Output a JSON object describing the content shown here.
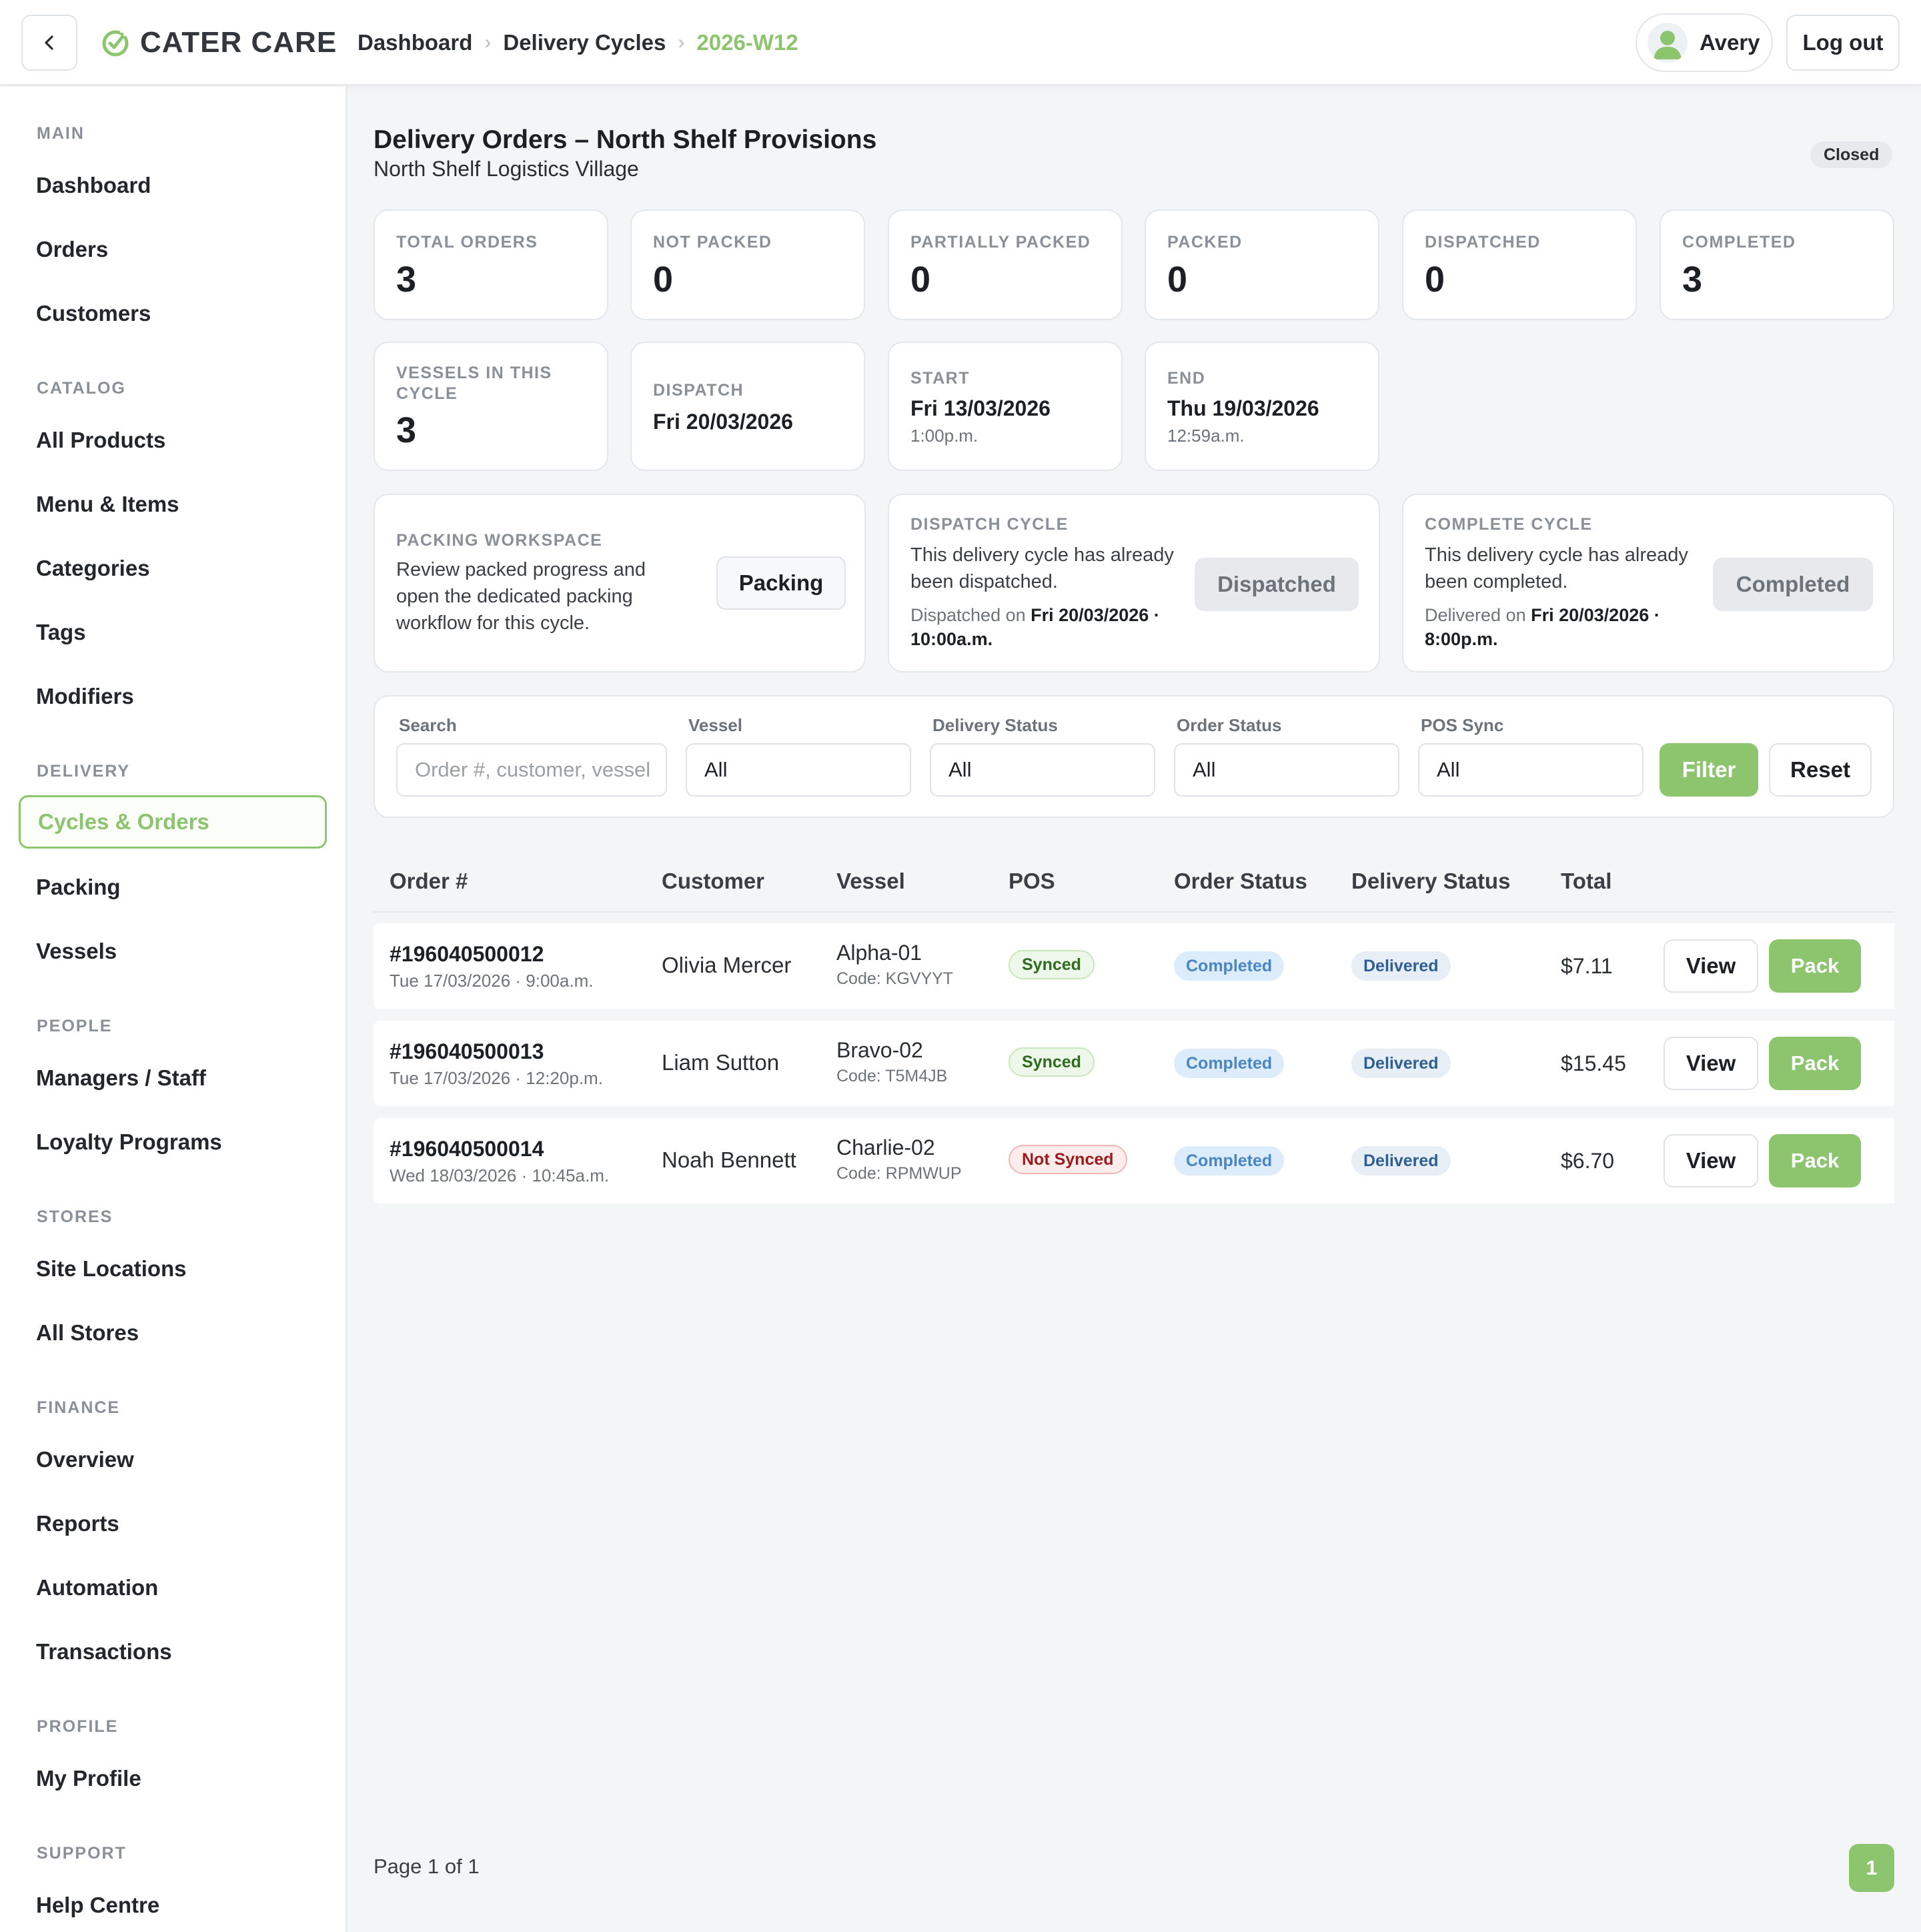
{
  "header": {
    "brand": "CATER CARE",
    "breadcrumbs": [
      "Dashboard",
      "Delivery Cycles",
      "2026-W12"
    ],
    "user_name": "Avery",
    "logout_label": "Log out"
  },
  "sidebar": {
    "sections": [
      {
        "title": "MAIN",
        "items": [
          "Dashboard",
          "Orders",
          "Customers"
        ]
      },
      {
        "title": "CATALOG",
        "items": [
          "All Products",
          "Menu & Items",
          "Categories",
          "Tags",
          "Modifiers"
        ]
      },
      {
        "title": "DELIVERY",
        "items": [
          "Cycles & Orders",
          "Packing",
          "Vessels"
        ]
      },
      {
        "title": "PEOPLE",
        "items": [
          "Managers / Staff",
          "Loyalty Programs"
        ]
      },
      {
        "title": "STORES",
        "items": [
          "Site Locations",
          "All Stores"
        ]
      },
      {
        "title": "FINANCE",
        "items": [
          "Overview",
          "Reports",
          "Automation",
          "Transactions"
        ]
      },
      {
        "title": "PROFILE",
        "items": [
          "My Profile"
        ]
      },
      {
        "title": "SUPPORT",
        "items": [
          "Help Centre"
        ]
      }
    ],
    "active_item": "Cycles & Orders"
  },
  "page": {
    "title": "Delivery Orders – North Shelf Provisions",
    "subtitle": "North Shelf Logistics Village",
    "status": "Closed"
  },
  "stats": [
    {
      "label": "TOTAL ORDERS",
      "value": "3"
    },
    {
      "label": "NOT PACKED",
      "value": "0"
    },
    {
      "label": "PARTIALLY PACKED",
      "value": "0"
    },
    {
      "label": "PACKED",
      "value": "0"
    },
    {
      "label": "DISPATCHED",
      "value": "0"
    },
    {
      "label": "COMPLETED",
      "value": "3"
    }
  ],
  "cycle_info": {
    "vessels_label": "VESSELS IN THIS CYCLE",
    "vessels_value": "3",
    "dispatch_label": "DISPATCH",
    "dispatch_value": "Fri 20/03/2026",
    "start_label": "START",
    "start_date": "Fri 13/03/2026",
    "start_time": "1:00p.m.",
    "end_label": "END",
    "end_date": "Thu 19/03/2026",
    "end_time": "12:59a.m."
  },
  "workspaces": {
    "packing": {
      "label": "PACKING WORKSPACE",
      "text": "Review packed progress and open the dedicated packing workflow for this cycle.",
      "button": "Packing"
    },
    "dispatch": {
      "label": "DISPATCH CYCLE",
      "text": "This delivery cycle has already been dispatched.",
      "meta_prefix": "Dispatched on",
      "meta_value": "Fri 20/03/2026 · 10:00a.m.",
      "button": "Dispatched"
    },
    "complete": {
      "label": "COMPLETE CYCLE",
      "text": "This delivery cycle has already been completed.",
      "meta_prefix": "Delivered on",
      "meta_value": "Fri 20/03/2026 · 8:00p.m.",
      "button": "Completed"
    }
  },
  "filters": {
    "search_label": "Search",
    "search_placeholder": "Order #, customer, vessel",
    "vessel_label": "Vessel",
    "vessel_value": "All",
    "delivery_status_label": "Delivery Status",
    "delivery_status_value": "All",
    "order_status_label": "Order Status",
    "order_status_value": "All",
    "pos_sync_label": "POS Sync",
    "pos_sync_value": "All",
    "filter_button": "Filter",
    "reset_button": "Reset"
  },
  "table": {
    "columns": [
      "Order #",
      "Customer",
      "Vessel",
      "POS",
      "Order Status",
      "Delivery Status",
      "Total"
    ],
    "rows": [
      {
        "order_no": "#196040500012",
        "date": "Tue 17/03/2026 · 9:00a.m.",
        "customer": "Olivia Mercer",
        "vessel": "Alpha-01",
        "vessel_code": "Code: KGVYYT",
        "pos": "Synced",
        "order_status": "Completed",
        "delivery_status": "Delivered",
        "total": "$7.11",
        "view": "View",
        "pack": "Pack"
      },
      {
        "order_no": "#196040500013",
        "date": "Tue 17/03/2026 · 12:20p.m.",
        "customer": "Liam Sutton",
        "vessel": "Bravo-02",
        "vessel_code": "Code: T5M4JB",
        "pos": "Synced",
        "order_status": "Completed",
        "delivery_status": "Delivered",
        "total": "$15.45",
        "view": "View",
        "pack": "Pack"
      },
      {
        "order_no": "#196040500014",
        "date": "Wed 18/03/2026 · 10:45a.m.",
        "customer": "Noah Bennett",
        "vessel": "Charlie-02",
        "vessel_code": "Code: RPMWUP",
        "pos": "Not Synced",
        "order_status": "Completed",
        "delivery_status": "Delivered",
        "total": "$6.70",
        "view": "View",
        "pack": "Pack"
      }
    ]
  },
  "pagination": {
    "text": "Page 1 of 1",
    "current_page": "1"
  },
  "colors": {
    "accent": "#8cc56d",
    "text": "#1c2024",
    "muted": "#8a9097"
  }
}
